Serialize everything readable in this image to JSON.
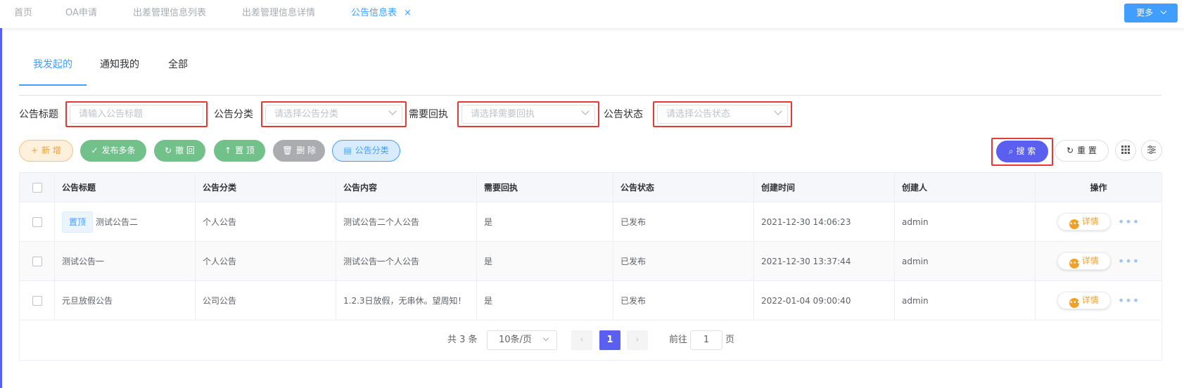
{
  "top_tabs": [
    {
      "label": "首页"
    },
    {
      "label": "OA申请"
    },
    {
      "label": "出差管理信息列表"
    },
    {
      "label": "出差管理信息详情"
    },
    {
      "label": "公告信息表",
      "close": "×"
    }
  ],
  "more_button": {
    "label": "更多"
  },
  "sub_tabs": [
    {
      "label": "我发起的"
    },
    {
      "label": "通知我的"
    },
    {
      "label": "全部"
    }
  ],
  "filters": {
    "title": {
      "label": "公告标题",
      "placeholder": "请输入公告标题"
    },
    "category": {
      "label": "公告分类",
      "placeholder": "请选择公告分类"
    },
    "receipt": {
      "label": "需要回执",
      "placeholder": "请选择需要回执"
    },
    "status": {
      "label": "公告状态",
      "placeholder": "请选择公告状态"
    }
  },
  "toolbar": {
    "add": {
      "icon": "+",
      "label": "新 增"
    },
    "publish": {
      "icon": "✓",
      "label": "发布多条"
    },
    "revoke": {
      "icon": "↻",
      "label": "撤 回"
    },
    "pin": {
      "icon": "↑",
      "label": "置 顶"
    },
    "delete": {
      "icon": "🗑",
      "label": "删 除"
    },
    "category": {
      "icon": "▤",
      "label": "公告分类"
    },
    "search": {
      "icon": "⌕",
      "label": "搜 索"
    },
    "reset": {
      "icon": "↻",
      "label": "重 置"
    }
  },
  "table": {
    "columns": [
      "公告标题",
      "公告分类",
      "公告内容",
      "需要回执",
      "公告状态",
      "创建时间",
      "创建人",
      "操作"
    ],
    "rows": [
      {
        "pin": "置顶",
        "title": "测试公告二",
        "category": "个人公告",
        "content": "测试公告二个人公告",
        "receipt": "是",
        "status": "已发布",
        "created": "2021-12-30 14:06:23",
        "creator": "admin",
        "action": "详情"
      },
      {
        "pin": "",
        "title": "测试公告一",
        "category": "个人公告",
        "content": "测试公告一个人公告",
        "receipt": "是",
        "status": "已发布",
        "created": "2021-12-30 13:37:44",
        "creator": "admin",
        "action": "详情"
      },
      {
        "pin": "",
        "title": "元旦放假公告",
        "category": "公司公告",
        "content": "1.2.3日放假，无串休。望周知！",
        "receipt": "是",
        "status": "已发布",
        "created": "2022-01-04 09:00:40",
        "creator": "admin",
        "action": "详情"
      }
    ]
  },
  "pagination": {
    "total_text": "共 3 条",
    "page_size": "10条/页",
    "current": "1",
    "goto_label": "前往",
    "goto_value": "1",
    "page_label": "页"
  },
  "colors": {
    "primary": "#409eff",
    "accent": "#5b5ff0",
    "success": "#72c08a",
    "warning": "#e6a23c",
    "highlight": "#e53935"
  }
}
